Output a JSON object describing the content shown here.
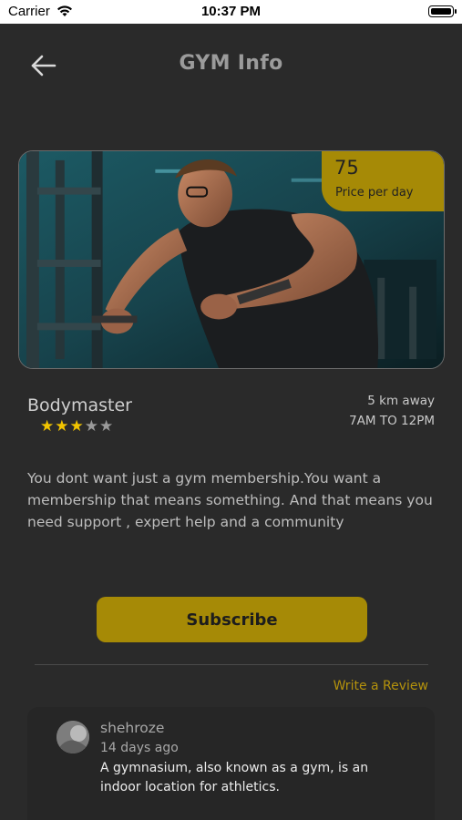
{
  "status_bar": {
    "carrier": "Carrier",
    "time": "10:37 PM"
  },
  "header": {
    "title": "GYM Info",
    "back_icon": "arrow-left-icon"
  },
  "hero": {
    "price": "75",
    "price_label": "Price per day"
  },
  "gym": {
    "name": "Bodymaster",
    "rating": 3,
    "rating_max": 5,
    "distance": "5 km away",
    "hours": "7AM TO 12PM",
    "description": "You dont want just a gym membership.You want a membership that means something. And that means you need support , expert help and a community"
  },
  "actions": {
    "subscribe_label": "Subscribe",
    "write_review_label": "Write a Review"
  },
  "reviews": [
    {
      "name": "shehroze",
      "date": "14 days ago",
      "text": "A gymnasium, also known as a gym, is an indoor location for athletics."
    }
  ],
  "colors": {
    "background": "#2a2a2a",
    "accent": "#a68a06",
    "star_on": "#f1c400",
    "star_off": "#9a9a9a",
    "link": "#b4920c"
  }
}
